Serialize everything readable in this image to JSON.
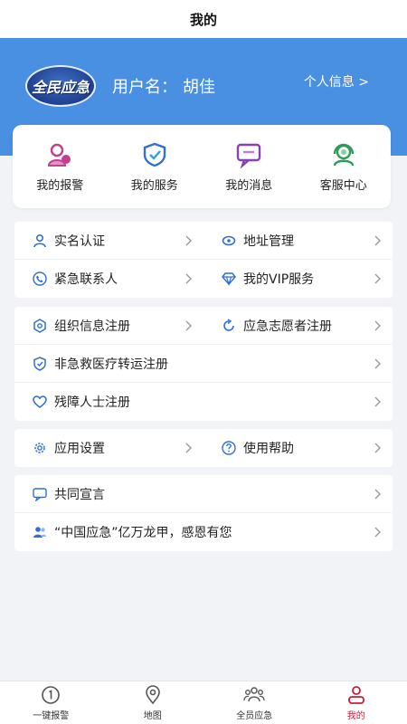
{
  "page": {
    "title": "我的"
  },
  "header": {
    "logo_text": "全民应急",
    "username_label": "用户名：",
    "username_value": "胡佳",
    "profile_link": "个人信息 >"
  },
  "quick_actions": [
    {
      "label": "我的报警",
      "icon": "user-alert-icon",
      "color": "#c2408f"
    },
    {
      "label": "我的服务",
      "icon": "shield-check-icon",
      "color": "#2f6fd8"
    },
    {
      "label": "我的消息",
      "icon": "chat-bubble-icon",
      "color": "#8a3fb5"
    },
    {
      "label": "客服中心",
      "icon": "headset-icon",
      "color": "#2a9d56"
    }
  ],
  "menu": {
    "g1": [
      {
        "label": "实名认证",
        "icon": "person-icon"
      },
      {
        "label": "地址管理",
        "icon": "location-pin-icon"
      },
      {
        "label": "紧急联系人",
        "icon": "phone-icon"
      },
      {
        "label": "我的VIP服务",
        "icon": "diamond-icon"
      }
    ],
    "g2": [
      {
        "label": "组织信息注册",
        "icon": "gear-badge-icon"
      },
      {
        "label": "应急志愿者注册",
        "icon": "refresh-icon"
      },
      {
        "label": "非急救医疗转运注册",
        "icon": "shield-icon"
      },
      {
        "label": "残障人士注册",
        "icon": "heart-icon"
      }
    ],
    "g3": [
      {
        "label": "应用设置",
        "icon": "settings-icon"
      },
      {
        "label": "使用帮助",
        "icon": "help-icon"
      }
    ],
    "g4": [
      {
        "label": "共同宣言",
        "icon": "chat-icon"
      },
      {
        "label": "“中国应急”亿万龙甲，感恩有您",
        "icon": "people-icon"
      }
    ]
  },
  "tabbar": [
    {
      "label": "一键报警",
      "icon": "alarm-one-icon"
    },
    {
      "label": "地图",
      "icon": "map-pin-icon"
    },
    {
      "label": "全员应急",
      "icon": "group-icon"
    },
    {
      "label": "我的",
      "icon": "user-icon",
      "active": true
    }
  ],
  "colors": {
    "header_blue": "#4a90e2",
    "icon_blue": "#2f6fd8",
    "active_red": "#c81e3a"
  }
}
